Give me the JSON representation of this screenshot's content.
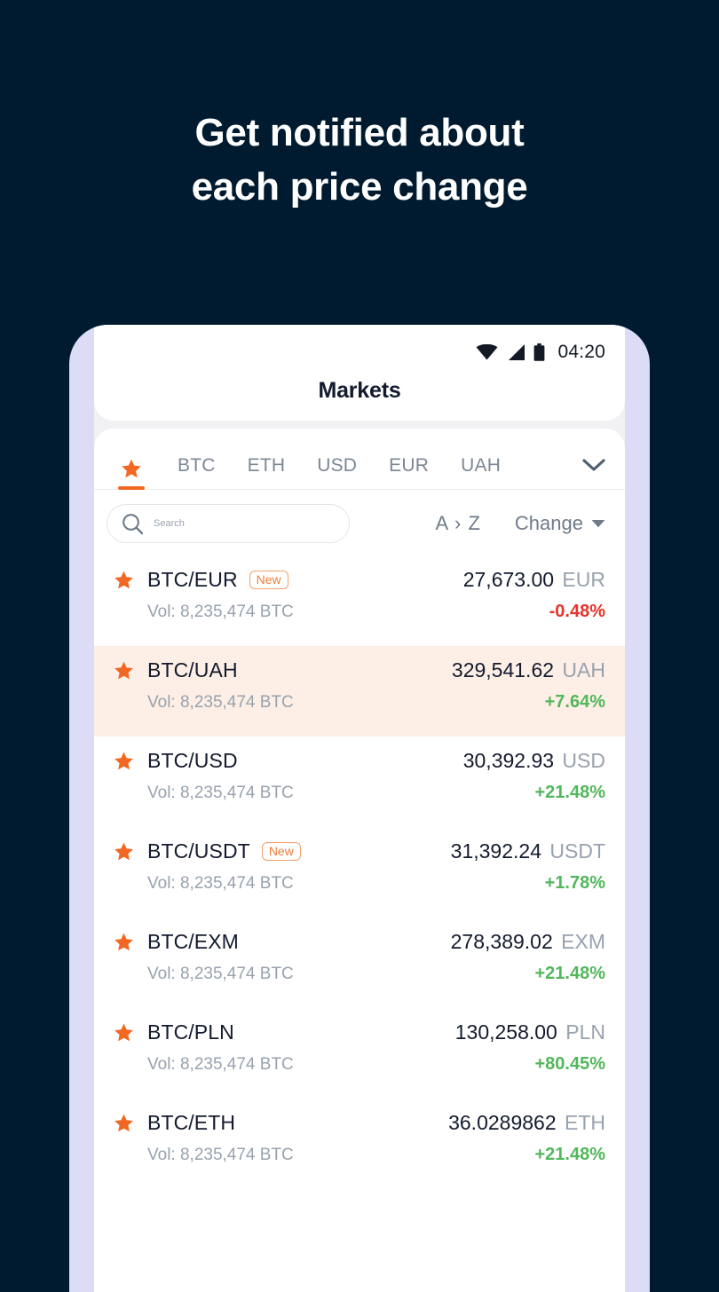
{
  "promo": {
    "headline_line1": "Get notified about",
    "headline_line2": "each price change"
  },
  "colors": {
    "background": "#001b30",
    "phone_frame": "#dcdcf6",
    "accent_orange": "#f26722",
    "up_green": "#51b75a",
    "down_red": "#e63329",
    "highlight_row": "#fdefe6",
    "muted_text": "#98a2ae"
  },
  "status_bar": {
    "time": "04:20",
    "icons": [
      "wifi-icon",
      "cellular-signal-icon",
      "battery-icon"
    ]
  },
  "header": {
    "title": "Markets"
  },
  "tabs": {
    "items": [
      {
        "label": "",
        "icon": "star-icon",
        "active": true
      },
      {
        "label": "BTC",
        "active": false
      },
      {
        "label": "ETH",
        "active": false
      },
      {
        "label": "USD",
        "active": false
      },
      {
        "label": "EUR",
        "active": false
      },
      {
        "label": "UAH",
        "active": false
      }
    ],
    "expand_icon": "chevron-down-icon"
  },
  "search": {
    "placeholder": "Search",
    "value": "",
    "icon": "search-icon"
  },
  "sort": {
    "alphabetical_label": "A › Z",
    "change_label": "Change",
    "change_caret": "caret-down-icon"
  },
  "market_list": {
    "volume_prefix": "Vol:",
    "new_badge_label": "New",
    "rows": [
      {
        "pair": "BTC/EUR",
        "is_new": true,
        "favorited": true,
        "price": "27,673.00",
        "currency": "EUR",
        "volume": "Vol: 8,235,474 BTC",
        "change": "-0.48%",
        "direction": "down",
        "highlighted": false
      },
      {
        "pair": "BTC/UAH",
        "is_new": false,
        "favorited": true,
        "price": "329,541.62",
        "currency": "UAH",
        "volume": "Vol: 8,235,474 BTC",
        "change": "+7.64%",
        "direction": "up",
        "highlighted": true
      },
      {
        "pair": "BTC/USD",
        "is_new": false,
        "favorited": true,
        "price": "30,392.93",
        "currency": "USD",
        "volume": "Vol: 8,235,474 BTC",
        "change": "+21.48%",
        "direction": "up",
        "highlighted": false
      },
      {
        "pair": "BTC/USDT",
        "is_new": true,
        "favorited": true,
        "price": "31,392.24",
        "currency": "USDT",
        "volume": "Vol: 8,235,474 BTC",
        "change": "+1.78%",
        "direction": "up",
        "highlighted": false
      },
      {
        "pair": "BTC/EXM",
        "is_new": false,
        "favorited": true,
        "price": "278,389.02",
        "currency": "EXM",
        "volume": "Vol: 8,235,474 BTC",
        "change": "+21.48%",
        "direction": "up",
        "highlighted": false
      },
      {
        "pair": "BTC/PLN",
        "is_new": false,
        "favorited": true,
        "price": "130,258.00",
        "currency": "PLN",
        "volume": "Vol: 8,235,474 BTC",
        "change": "+80.45%",
        "direction": "up",
        "highlighted": false
      },
      {
        "pair": "BTC/ETH",
        "is_new": false,
        "favorited": true,
        "price": "36.0289862",
        "currency": "ETH",
        "volume": "Vol: 8,235,474 BTC",
        "change": "+21.48%",
        "direction": "up",
        "highlighted": false
      }
    ]
  }
}
